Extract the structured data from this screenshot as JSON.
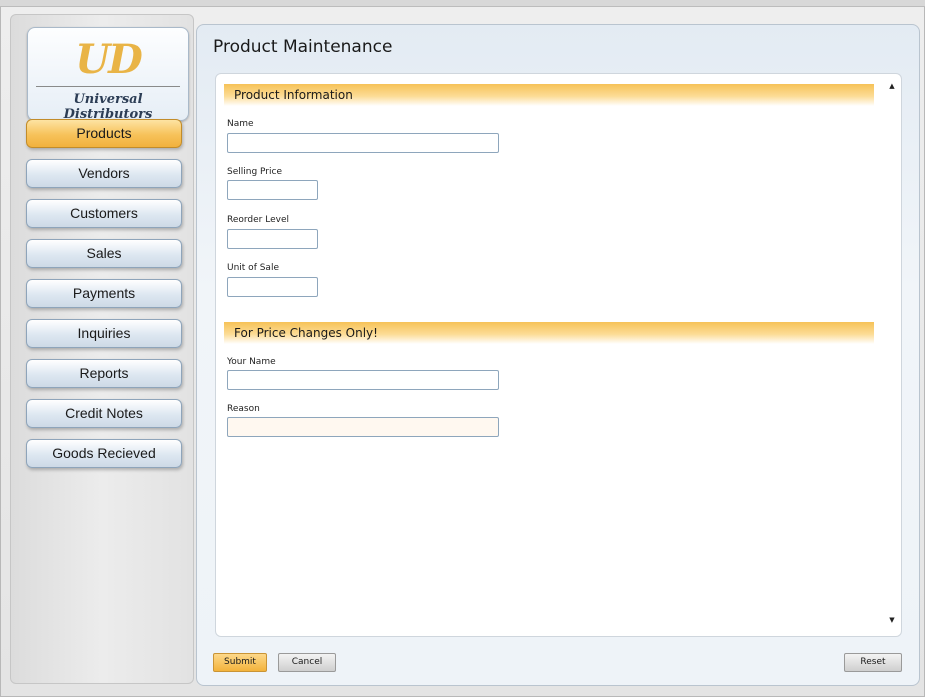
{
  "logo": {
    "mark": "UD",
    "name": "Universal Distributors"
  },
  "nav": [
    {
      "label": "Products",
      "active": true
    },
    {
      "label": "Vendors"
    },
    {
      "label": "Customers"
    },
    {
      "label": "Sales"
    },
    {
      "label": "Payments"
    },
    {
      "label": "Inquiries"
    },
    {
      "label": "Reports"
    },
    {
      "label": "Credit Notes"
    },
    {
      "label": "Goods Recieved"
    }
  ],
  "page": {
    "title": "Product Maintenance"
  },
  "sections": {
    "product_info": {
      "title": "Product Information",
      "fields": {
        "name": {
          "label": "Name",
          "value": ""
        },
        "selling_price": {
          "label": "Selling Price",
          "value": ""
        },
        "reorder_level": {
          "label": "Reorder Level",
          "value": ""
        },
        "unit_of_sale": {
          "label": "Unit of Sale",
          "value": ""
        }
      }
    },
    "price_changes": {
      "title": "For Price Changes Only!",
      "fields": {
        "your_name": {
          "label": "Your Name",
          "value": ""
        },
        "reason": {
          "label": "Reason",
          "value": ""
        }
      }
    }
  },
  "footer": {
    "submit_label": "Submit",
    "cancel_label": "Cancel",
    "reset_label": "Reset"
  },
  "colors": {
    "accent": "#f4b846",
    "panel_border": "#b9c4cf",
    "nav_button": "#dde7f1"
  }
}
